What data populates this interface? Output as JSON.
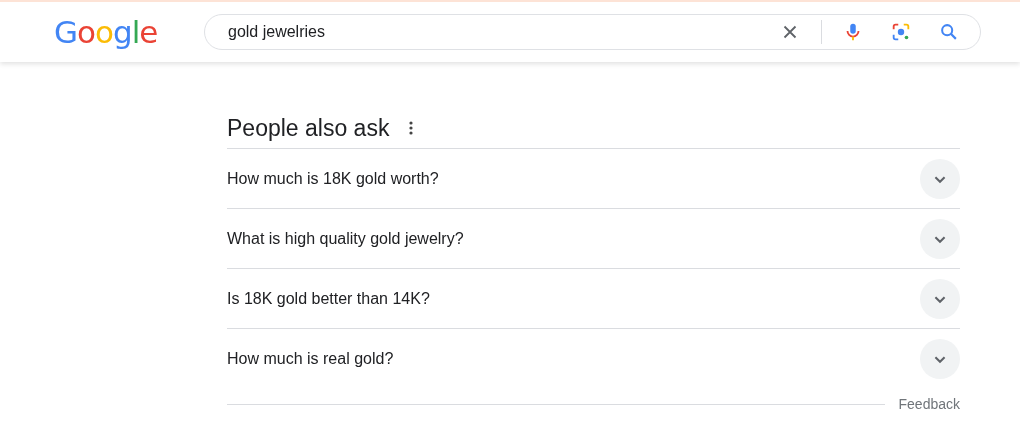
{
  "header": {
    "logo": [
      {
        "char": "G",
        "color": "#4285f4"
      },
      {
        "char": "o",
        "color": "#ea4335"
      },
      {
        "char": "o",
        "color": "#fbbc05"
      },
      {
        "char": "g",
        "color": "#4285f4"
      },
      {
        "char": "l",
        "color": "#34a853"
      },
      {
        "char": "e",
        "color": "#ea4335"
      }
    ],
    "search": {
      "value": "gold jewelries"
    }
  },
  "people_also_ask": {
    "title": "People also ask",
    "questions": [
      {
        "text": "How much is 18K gold worth?",
        "expanded": false
      },
      {
        "text": "What is high quality gold jewelry?",
        "expanded": false
      },
      {
        "text": "Is 18K gold better than 14K?",
        "expanded": false
      },
      {
        "text": "How much is real gold?",
        "expanded": false
      }
    ],
    "feedback": "Feedback"
  }
}
